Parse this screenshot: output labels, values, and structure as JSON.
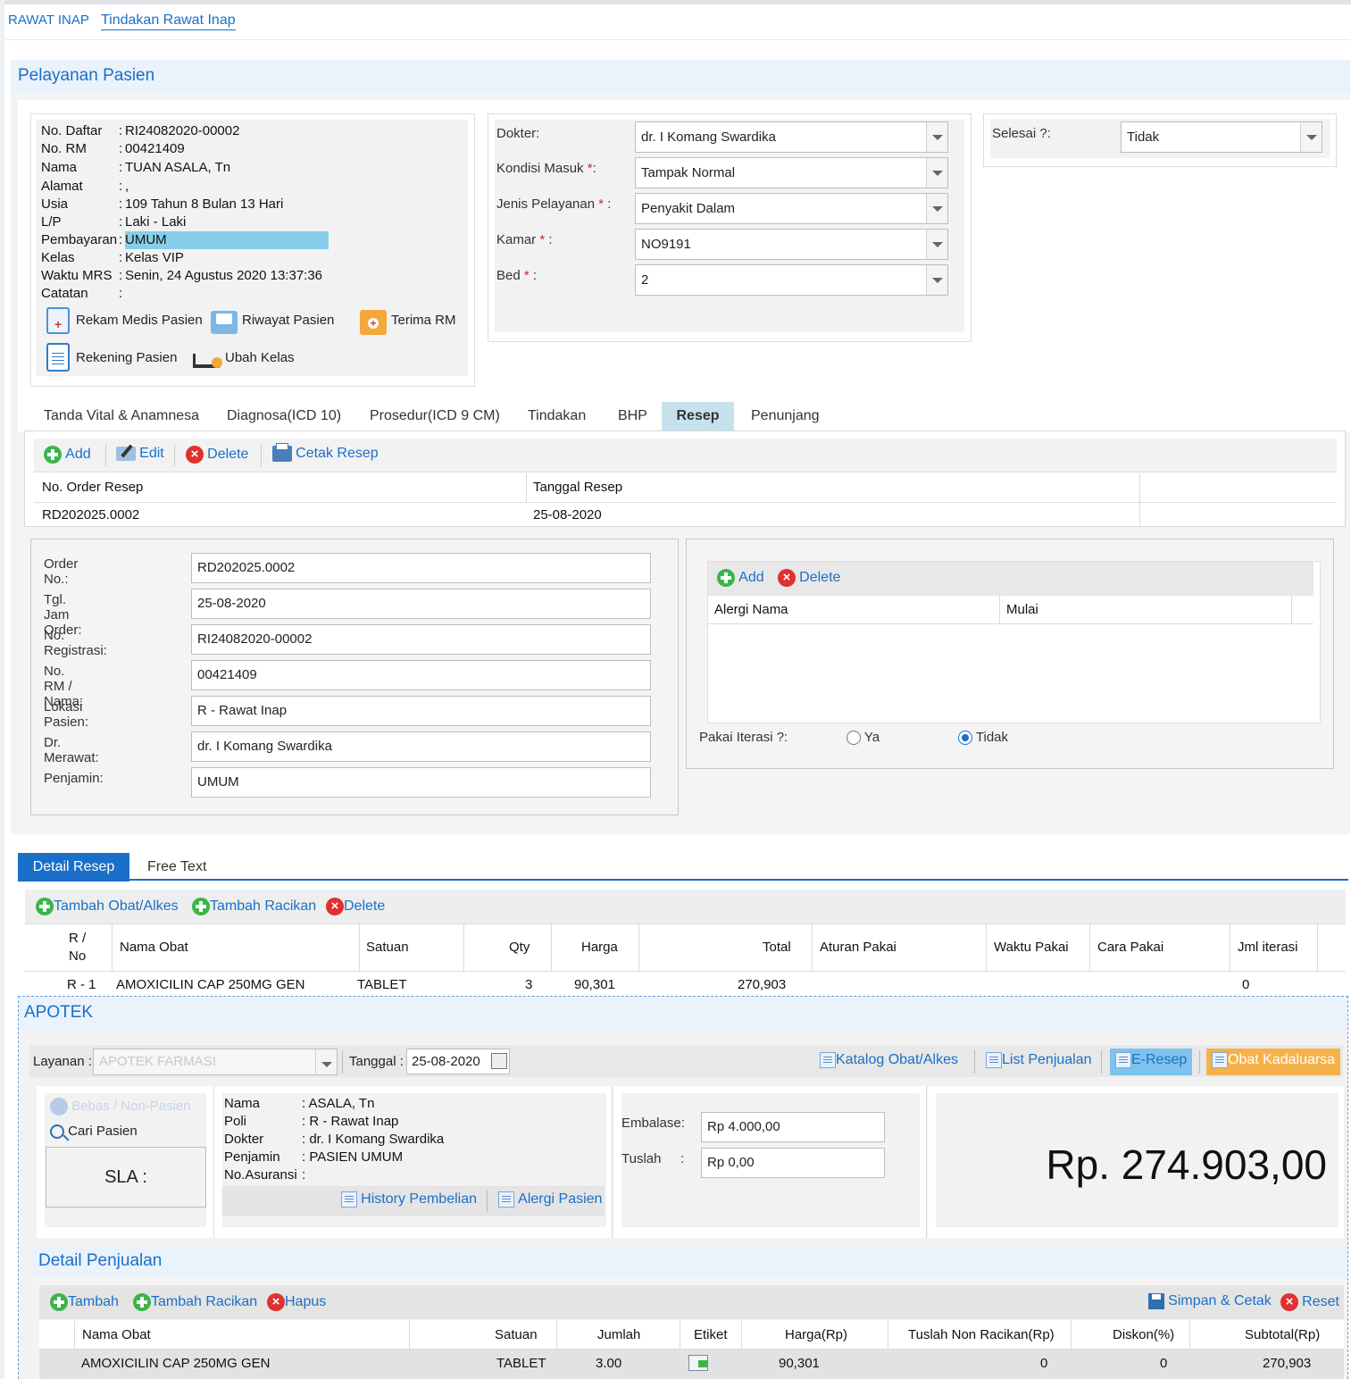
{
  "breadcrumb": {
    "root": "RAWAT INAP",
    "current": "Tindakan Rawat Inap"
  },
  "pelayanan": {
    "title": "Pelayanan Pasien"
  },
  "patient": {
    "rows": [
      {
        "k": "No. Daftar",
        "v": "RI24082020-00002"
      },
      {
        "k": "No. RM",
        "v": "00421409"
      },
      {
        "k": "Nama",
        "v": "TUAN ASALA, Tn"
      },
      {
        "k": "Alamat",
        "v": ","
      },
      {
        "k": "Usia",
        "v": "109 Tahun 8 Bulan 13 Hari"
      },
      {
        "k": "L/P",
        "v": "Laki - Laki"
      },
      {
        "k": "Pembayaran",
        "v": "UMUM"
      },
      {
        "k": "Kelas",
        "v": "Kelas VIP"
      },
      {
        "k": "Waktu MRS",
        "v": "Senin, 24 Agustus 2020 13:37:36"
      },
      {
        "k": "Catatan",
        "v": ""
      }
    ],
    "colon": ":",
    "actions": {
      "rekam_medis": "Rekam Medis Pasien",
      "riwayat": "Riwayat Pasien",
      "terima_rm": "Terima RM",
      "rekening": "Rekening Pasien",
      "ubah_kelas": "Ubah Kelas"
    }
  },
  "form": {
    "dokter_label": "Dokter:",
    "dokter": "dr. I Komang Swardika",
    "kondisi_label": "Kondisi Masuk",
    "kondisi": "Tampak Normal",
    "jenis_label": "Jenis Pelayanan",
    "jenis": "Penyakit Dalam",
    "kamar_label": "Kamar",
    "kamar": "NO9191",
    "bed_label": "Bed",
    "bed": "2",
    "req": "*",
    "colon": ":",
    "colon2": " :",
    "selesai_label": "Selesai ?:",
    "selesai": "Tidak"
  },
  "tabs": [
    "Tanda Vital & Anamnesa",
    "Diagnosa(ICD 10)",
    "Prosedur(ICD 9 CM)",
    "Tindakan",
    "BHP",
    "Resep",
    "Penunjang"
  ],
  "resep_toolbar": {
    "add": "Add",
    "edit": "Edit",
    "delete": "Delete",
    "cetak": "Cetak Resep"
  },
  "resep_table": {
    "headers": [
      "No. Order Resep",
      "Tanggal Resep"
    ],
    "rows": [
      [
        "RD202025.0002",
        "25-08-2020"
      ]
    ]
  },
  "order": {
    "fields": [
      {
        "label": "Order No.:",
        "value": "RD202025.0002"
      },
      {
        "label": "Tgl. Jam Order:",
        "value": "25-08-2020"
      },
      {
        "label": "No. Registrasi:",
        "value": "RI24082020-00002"
      },
      {
        "label": "No. RM / Nama:",
        "value": "00421409"
      },
      {
        "label": "Lokasi Pasien:",
        "value": "R - Rawat Inap"
      },
      {
        "label": "Dr. Merawat:",
        "value": "dr. I Komang Swardika"
      },
      {
        "label": "Penjamin:",
        "value": "UMUM"
      }
    ]
  },
  "alergi": {
    "add": "Add",
    "delete": "Delete",
    "headers": [
      "Alergi Nama",
      "Mulai"
    ],
    "iterasi_label": "Pakai Iterasi ?:",
    "ya": "Ya",
    "tidak": "Tidak",
    "selected": "Tidak"
  },
  "detail_tabs": [
    "Detail Resep",
    "Free Text"
  ],
  "detail_toolbar": {
    "tambah_obat": "Tambah Obat/Alkes",
    "tambah_racikan": "Tambah Racikan",
    "delete": "Delete"
  },
  "detail_table": {
    "headers": {
      "rno": "R / No",
      "nama": "Nama Obat",
      "satuan": "Satuan",
      "qty": "Qty",
      "harga": "Harga",
      "total": "Total",
      "aturan": "Aturan Pakai",
      "waktu": "Waktu Pakai",
      "cara": "Cara Pakai",
      "iterasi": "Jml iterasi"
    },
    "rows": [
      {
        "rno": "R - 1",
        "nama": "AMOXICILIN CAP 250MG GEN",
        "satuan": "TABLET",
        "qty": "3",
        "harga": "90,301",
        "total": "270,903",
        "iterasi": "0"
      }
    ]
  },
  "apotek": {
    "title": "APOTEK",
    "layanan_label": "Layanan :",
    "layanan": "APOTEK FARMASI",
    "tanggal_label": "Tanggal :",
    "tanggal": "25-08-2020",
    "katalog": "Katalog Obat/Alkes",
    "list_penjualan": "List Penjualan",
    "eresep": "E-Resep",
    "kadaluarsa": "Obat Kadaluarsa",
    "bebas": "Bebas / Non-Pasien",
    "cari": "Cari Pasien",
    "sla": "SLA :",
    "info": [
      {
        "k": "Nama",
        "v": ": ASALA, Tn"
      },
      {
        "k": "Poli",
        "v": ": R - Rawat Inap"
      },
      {
        "k": "Dokter",
        "v": ": dr. I Komang Swardika"
      },
      {
        "k": "Penjamin",
        "v": ": PASIEN UMUM"
      },
      {
        "k": "No.Asuransi",
        "v": ":"
      }
    ],
    "history": "History Pembelian",
    "alergi": "Alergi Pasien",
    "embalase_label": "Embalase:",
    "embalase": "Rp 4.000,00",
    "tuslah_label": "Tuslah",
    "tuslah_colon": ":",
    "tuslah": "Rp 0,00",
    "total": "Rp. 274.903,00"
  },
  "penjualan": {
    "title": "Detail Penjualan",
    "tambah": "Tambah",
    "tambah_racikan": "Tambah Racikan",
    "hapus": "Hapus",
    "simpan": "Simpan & Cetak",
    "reset": "Reset",
    "headers": {
      "nama": "Nama Obat",
      "satuan": "Satuan",
      "jumlah": "Jumlah",
      "etiket": "Etiket",
      "harga": "Harga(Rp)",
      "tuslah": "Tuslah Non Racikan(Rp)",
      "diskon": "Diskon(%)",
      "subtotal": "Subtotal(Rp)"
    },
    "rows": [
      {
        "nama": "AMOXICILIN CAP 250MG GEN",
        "satuan": "TABLET",
        "jumlah": "3.00",
        "harga": "90,301",
        "tuslah": "0",
        "diskon": "0",
        "subtotal": "270,903"
      }
    ]
  }
}
